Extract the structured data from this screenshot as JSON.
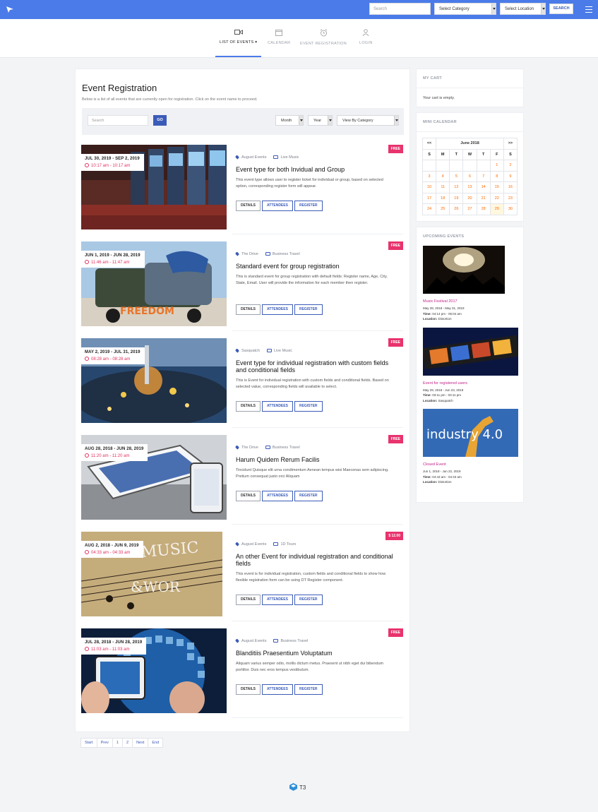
{
  "topbar": {
    "search_placeholder": "Search",
    "category_select": "Select Category",
    "location_select": "Select Location",
    "search_button": "SEARCH"
  },
  "nav": [
    {
      "label": "LIST OF EVENTS",
      "icon": "video-icon",
      "active": true
    },
    {
      "label": "CALENDAR",
      "icon": "calendar-icon",
      "active": false
    },
    {
      "label": "EVENT REGISTRATION",
      "icon": "alarm-clock-icon",
      "active": false
    },
    {
      "label": "LOGIN",
      "icon": "user-icon",
      "active": false
    }
  ],
  "main": {
    "title": "Event Registration",
    "description": "Below is a list of all events that are currently open for registration. Click on the event name to proceed.",
    "filters": {
      "search_placeholder": "Search",
      "go_label": "GO",
      "month": "Month",
      "year": "Year",
      "category": "View By Category"
    }
  },
  "buttons": {
    "details": "DETAILS",
    "attendees": "ATTENDEES",
    "register": "REGISTER"
  },
  "events": [
    {
      "date": "JUL 30, 2019 - SEP 2, 2019",
      "time": "10:17 am - 10:17 am",
      "badge": "FREE",
      "location": "August Events",
      "category": "Live Music",
      "title": "Event type for both Invidual and Group",
      "description": "This event type allows user to register ticket for individual or group, based on selected option, corresponding register form will appear.",
      "image": "casino-slot-machines"
    },
    {
      "date": "JUN 1, 2019 - JUN 28, 2019",
      "time": "11:46 am - 11:47 am",
      "badge": "FREE",
      "location": "The Drive",
      "category": "Business Travel",
      "title": "Standard event for group registration",
      "description": "This is standard event for group registration with default fields: Register name, Age, City, State, Email. User will provide the information for each member then register.",
      "image": "freedom-truck"
    },
    {
      "date": "MAY 2, 2019 - JUL 31, 2019",
      "time": "08:28 am - 08:28 am",
      "badge": "FREE",
      "location": "Sasquatch",
      "category": "Live Music",
      "title": "Event type for individual registration with custom fields and conditional fields",
      "description": "This is Event for individual registration with custom fields and conditional fields. Based on selected value, corresponding fields will available to select.",
      "image": "city-night"
    },
    {
      "date": "AUG 28, 2018 - JUN 28, 2019",
      "time": "11:20 am - 11:20 am",
      "badge": "FREE",
      "location": "The Drive",
      "category": "Business Travel",
      "title": "Harum Quidem Rerum Facilis",
      "description": "Tincidunt Quisque elit urna condimentum Aenean tempus wisi Maecenas sem adipiscing. Pretium consequat justo orci Aliquam",
      "image": "devices"
    },
    {
      "date": "AUG 2, 2018 - JUN 9, 2019",
      "time": "04:33 am - 04:33 am",
      "badge": "$ 12.00",
      "location": "August Events",
      "category": "1D Tours",
      "title": "An other Event for individual registration and conditional fields",
      "description": "This event is for individual registration, custom fields and conditional fields to show how flexible registration form can be using DT Register component.",
      "image": "music-world"
    },
    {
      "date": "JUL 28, 2018 - JUN 28, 2019",
      "time": "11:03 am - 11:03 am",
      "badge": "FREE",
      "location": "August Events",
      "category": "Business Travel",
      "title": "Blanditiis Praesentium Voluptatum",
      "description": "Aliquam varius semper odio, mollis dictum metus. Praesent ut nibh eget dui bibendum porttitor. Duis nec eros tempus vestibulum.",
      "image": "phone-globe"
    }
  ],
  "pagination": [
    "Start",
    "Prev",
    "1",
    "2",
    "Next",
    "End"
  ],
  "sidebar": {
    "cart": {
      "title": "MY CART",
      "text": "Your cart is empty."
    },
    "calendar": {
      "title": "MINI CALENDAR",
      "prev": "<<",
      "next": ">>",
      "month": "June 2018",
      "weekdays": [
        "S",
        "M",
        "T",
        "W",
        "T",
        "F",
        "S"
      ],
      "weeks": [
        [
          "",
          "",
          "",
          "",
          "",
          "1",
          "2"
        ],
        [
          "3",
          "4",
          "5",
          "6",
          "7",
          "8",
          "9"
        ],
        [
          "10",
          "11",
          "12",
          "13",
          "14",
          "15",
          "16"
        ],
        [
          "17",
          "18",
          "19",
          "20",
          "21",
          "22",
          "23"
        ],
        [
          "24",
          "25",
          "26",
          "27",
          "28",
          "29",
          "30"
        ]
      ]
    },
    "upcoming": {
      "title": "UPCOMING EVENTS",
      "items": [
        {
          "title": "Music Festival 2017",
          "dates": "May 28, 2018 - May 31, 2019",
          "time_label": "Time:",
          "time": "04:14 pm - 05:04 am",
          "location_label": "Location:",
          "location": "Distortion",
          "image": "concert"
        },
        {
          "title": "Event for registered users",
          "dates": "May 29, 2018 - Jun 23, 2019",
          "time_label": "Time:",
          "time": "03:11 pm - 03:11 pm",
          "location_label": "Location:",
          "location": "Sasquatch",
          "image": "film-strip"
        },
        {
          "title": "Closed Event",
          "dates": "Jun 1, 2018 - Jun 22, 2019",
          "time_label": "Time:",
          "time": "04:43 am - 04:43 am",
          "location_label": "Location:",
          "location": "Distortion",
          "image": "industry-4-robot",
          "image_text": "industry 4.0"
        }
      ]
    }
  },
  "footer": {
    "brand": "T3"
  }
}
